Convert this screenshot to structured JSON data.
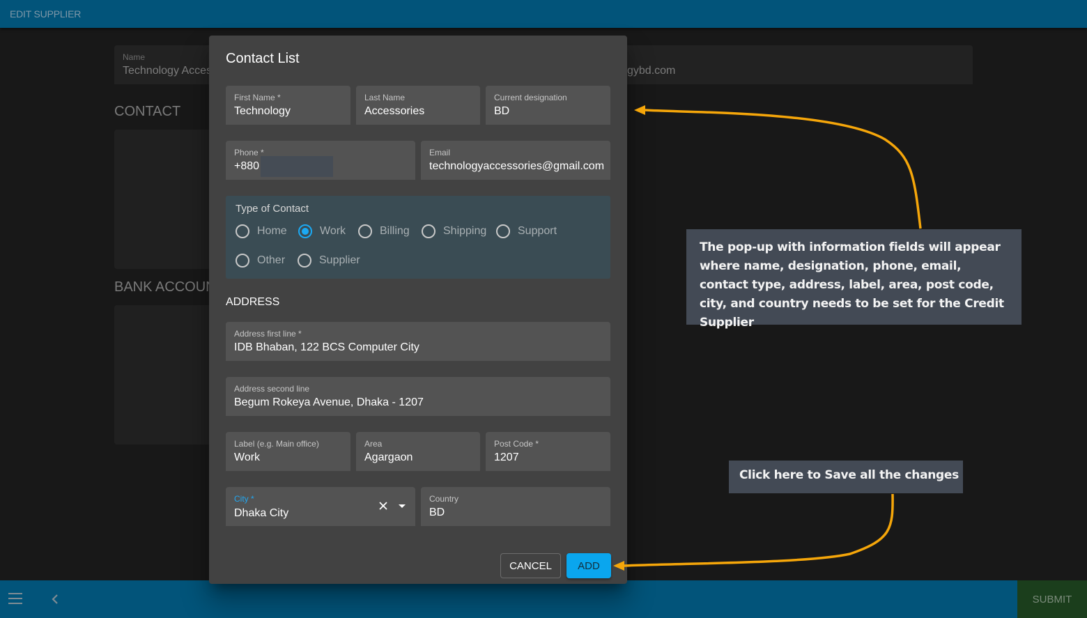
{
  "app": {
    "title": "EDIT SUPPLIER"
  },
  "background": {
    "name_field": {
      "label": "Name",
      "value": "Technology Acces"
    },
    "email_partial": "gybd.com",
    "sections": [
      "CONTACT",
      "BANK ACCOUN"
    ]
  },
  "modal": {
    "title": "Contact List",
    "fields": {
      "first_name": {
        "label": "First Name *",
        "value": "Technology"
      },
      "last_name": {
        "label": "Last Name",
        "value": "Accessories"
      },
      "designation": {
        "label": "Current designation",
        "value": "BD"
      },
      "phone": {
        "label": "Phone *",
        "value": "+880"
      },
      "email": {
        "label": "Email",
        "value": "technologyaccessories@gmail.com"
      },
      "address1": {
        "label": "Address first line *",
        "value": "IDB Bhaban, 122 BCS Computer City"
      },
      "address2": {
        "label": "Address second line",
        "value": "Begum Rokeya Avenue, Dhaka - 1207"
      },
      "label": {
        "label": "Label (e.g. Main office)",
        "value": "Work"
      },
      "area": {
        "label": "Area",
        "value": "Agargaon"
      },
      "post_code": {
        "label": "Post Code *",
        "value": "1207"
      },
      "city": {
        "label": "City *",
        "value": "Dhaka City"
      },
      "country": {
        "label": "Country",
        "value": "BD"
      }
    },
    "contact_type": {
      "title": "Type of Contact",
      "options": [
        {
          "label": "Home",
          "checked": false
        },
        {
          "label": "Work",
          "checked": true
        },
        {
          "label": "Billing",
          "checked": false
        },
        {
          "label": "Shipping",
          "checked": false
        },
        {
          "label": "Support",
          "checked": false
        },
        {
          "label": "Other",
          "checked": false
        },
        {
          "label": "Supplier",
          "checked": false
        }
      ],
      "selected": "Work"
    },
    "address_heading": "ADDRESS",
    "buttons": {
      "cancel": "CANCEL",
      "add": "ADD"
    }
  },
  "bottombar": {
    "submit_label": "SUBMIT"
  },
  "annotations": {
    "popup_note": "The pop-up with information fields will appear where name, designation, phone, email, contact type, address, label, area, post code, city, and country needs to be set for the Credit Supplier",
    "save_note": "Click here to Save all the changes"
  },
  "colors": {
    "appbar": "#02547a",
    "accent": "#0aa6ee",
    "submit_bg": "#1b3e1c",
    "annotation_arrow": "#f5a60a"
  }
}
